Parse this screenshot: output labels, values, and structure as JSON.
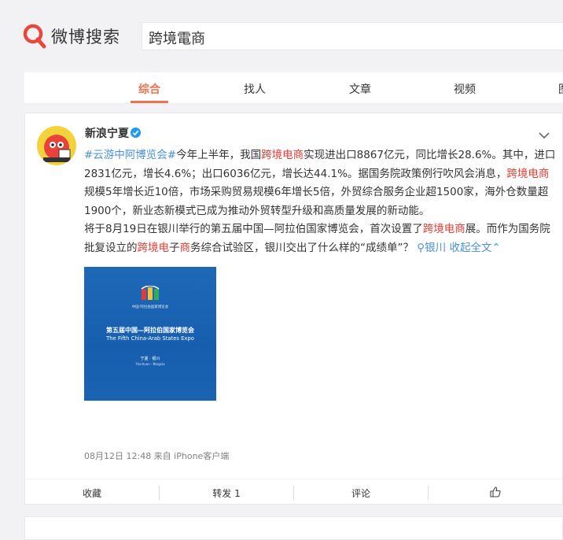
{
  "header": {
    "logo_text": "微博搜索",
    "search_value": "跨境電商"
  },
  "tabs": [
    {
      "label": "综合",
      "active": true
    },
    {
      "label": "找人"
    },
    {
      "label": "文章"
    },
    {
      "label": "视频"
    }
  ],
  "post": {
    "username": "新浪宁夏",
    "verified": true,
    "p1": [
      {
        "text": "#云游中阿博览会#",
        "type": "tag"
      },
      {
        "text": "今年上半年，我国",
        "type": "plain"
      },
      {
        "text": "跨境电商",
        "type": "hl"
      },
      {
        "text": "实现进出口8867亿元，同比增长28.6%。其中，进口2831亿元，增长4.6%；出口6036亿元，增长达44.1%。据国务院政策例行吹风会消息，",
        "type": "plain"
      },
      {
        "text": "跨境电商",
        "type": "hl"
      },
      {
        "text": "规模5年增长近10倍，市场采购贸易规模6年增长5倍，外贸综合服务企业超1500家，海外仓数量超1900个，新业态新模式已成为推动外贸转型升级和高质量发展的新动能。",
        "type": "plain"
      }
    ],
    "p2": [
      {
        "text": "将于8月19日在银川举行的第五届中国—阿拉伯国家博览会，首次设置了",
        "type": "plain"
      },
      {
        "text": "跨境电商",
        "type": "hl"
      },
      {
        "text": "展。而作为国务院批复设立的",
        "type": "plain"
      },
      {
        "text": "跨境电",
        "type": "hl"
      },
      {
        "text": "子",
        "type": "plain"
      },
      {
        "text": "商",
        "type": "hl"
      },
      {
        "text": "务综合试验区，银川交出了什么样的“成绩单”？",
        "type": "plain"
      },
      {
        "text": " ⚲银川",
        "type": "link"
      },
      {
        "text": " 收起全文",
        "type": "link"
      }
    ],
    "image": {
      "top_text": "中国-阿拉伯国家博览会",
      "cn_title": "第五届中国—阿拉伯国家博览会",
      "en_title": "The Fifth China-Arab States Expo",
      "place": "宁夏 · 银川",
      "place_en": "Yinchuan · Ningxia"
    },
    "meta": "08月12日 12:48  来自 iPhone客户端",
    "actions": {
      "collect": "收藏",
      "repost": "转发 1",
      "comment": "评论"
    }
  },
  "colors": {
    "accent": "#eb7350",
    "highlight": "#e33c32",
    "link": "#4a90d9",
    "image_bg": "#1a62b2"
  }
}
